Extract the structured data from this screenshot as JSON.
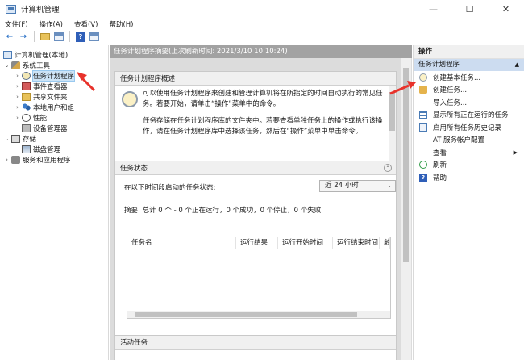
{
  "window": {
    "title": "计算机管理",
    "minimize": "—",
    "maximize": "☐",
    "close": "✕"
  },
  "menu": [
    "文件(F)",
    "操作(A)",
    "查看(V)",
    "帮助(H)"
  ],
  "toolbar": {
    "back": "←",
    "forward": "→",
    "help": "?"
  },
  "tree": {
    "root": "计算机管理(本地)",
    "system_tools": "系统工具",
    "task_scheduler": "任务计划程序",
    "event_viewer": "事件查看器",
    "shared_folders": "共享文件夹",
    "local_users": "本地用户和组",
    "performance": "性能",
    "device_manager": "设备管理器",
    "storage": "存储",
    "disk_management": "磁盘管理",
    "services": "服务和应用程序"
  },
  "center": {
    "header": "任务计划程序摘要(上次刷新时间: 2021/3/10 10:10:24)",
    "overview_title": "任务计划程序概述",
    "overview_line1": "可以使用任务计划程序来创建和管理计算机将在所指定的时间自动执行的常见任",
    "overview_line2": "务。若要开始，请单击“操作”菜单中的命令。",
    "overview_line3": "任务存储在任务计划程序库的文件夹中。若要查看单独任务上的操作或执行该操",
    "overview_line4": "作，请在任务计划程序库中选择该任务，然后在“操作”菜单中单击命令。",
    "status_title": "任务状态",
    "status_label": "在以下时间段启动的任务状态:",
    "range_value": "近 24 小时",
    "summary": "摘要: 总计 0 个 - 0 个正在运行，0 个成功，0 个停止，0 个失败",
    "columns": [
      "任务名",
      "运行结果",
      "运行开始时间",
      "运行结束时间",
      "触"
    ],
    "active_title": "活动任务"
  },
  "actions": {
    "title": "操作",
    "group": "任务计划程序",
    "items": [
      {
        "label": "创建基本任务...",
        "icon": "basic-task-icon"
      },
      {
        "label": "创建任务...",
        "icon": "create-task-icon"
      },
      {
        "label": "导入任务...",
        "icon": ""
      },
      {
        "label": "显示所有正在运行的任务",
        "icon": "running-tasks-icon"
      },
      {
        "label": "启用所有任务历史记录",
        "icon": "history-icon"
      },
      {
        "label": "AT 服务帐户配置",
        "icon": ""
      },
      {
        "label": "查看",
        "icon": ""
      },
      {
        "label": "刷新",
        "icon": "refresh-icon"
      },
      {
        "label": "帮助",
        "icon": "help-icon"
      }
    ]
  },
  "colors": {
    "arrow": "#e8322b",
    "header_bg": "#a2a2a2",
    "selection": "#cde4f7"
  }
}
